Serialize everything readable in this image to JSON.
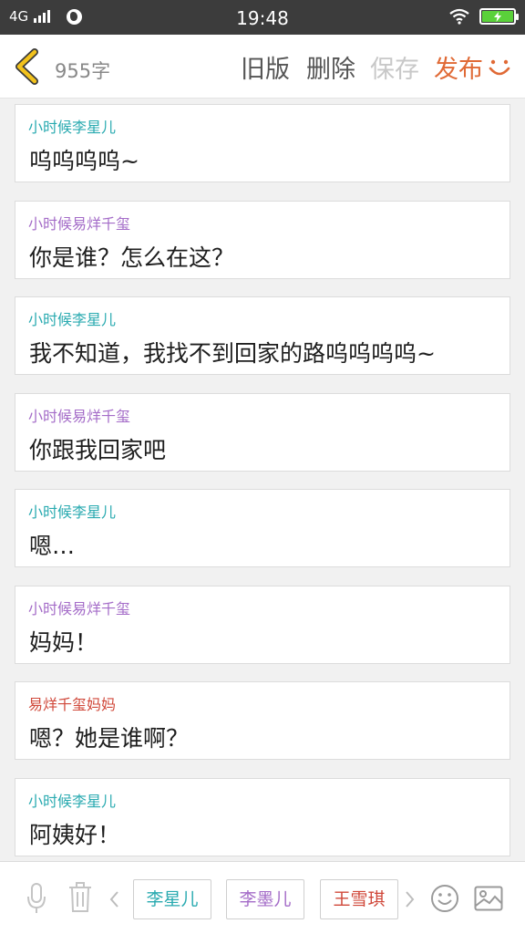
{
  "status_bar": {
    "network": "4G",
    "time": "19:48",
    "battery_level": 1.0,
    "battery_charging_icon": "lightning-bolt-icon"
  },
  "toolbar": {
    "back_icon": "chevron-left-icon",
    "word_count": "955字",
    "old_version_label": "旧版",
    "delete_label": "删除",
    "save_label": "保存",
    "publish_label": "发布",
    "smile_icon": "smile-icon"
  },
  "colors": {
    "teal": "#29aab0",
    "purple": "#a46cc8",
    "red": "#d0483a",
    "publish": "#e06a36",
    "back_arrow": "#f2c21c"
  },
  "messages": [
    {
      "speaker": "小时候李星儿",
      "text": "呜呜呜呜~",
      "color": "#29aab0"
    },
    {
      "speaker": "小时候易烊千玺",
      "text": "你是谁？怎么在这？",
      "color": "#a46cc8"
    },
    {
      "speaker": "小时候李星儿",
      "text": "我不知道，我找不到回家的路呜呜呜呜~",
      "color": "#29aab0"
    },
    {
      "speaker": "小时候易烊千玺",
      "text": "你跟我回家吧",
      "color": "#a46cc8"
    },
    {
      "speaker": "小时候李星儿",
      "text": "嗯…",
      "color": "#29aab0"
    },
    {
      "speaker": "小时候易烊千玺",
      "text": "妈妈！",
      "color": "#a46cc8"
    },
    {
      "speaker": "易烊千玺妈妈",
      "text": "嗯？她是谁啊？",
      "color": "#d0483a"
    },
    {
      "speaker": "小时候李星儿",
      "text": "阿姨好！",
      "color": "#29aab0"
    }
  ],
  "bottom_bar": {
    "mic_icon": "microphone-icon",
    "trash_icon": "trash-icon",
    "prev_icon": "chevron-left-icon",
    "next_icon": "chevron-right-icon",
    "emoji_icon": "emoji-icon",
    "image_icon": "image-icon",
    "characters": [
      {
        "name": "李星儿",
        "color": "#29aab0"
      },
      {
        "name": "李墨儿",
        "color": "#a46cc8"
      },
      {
        "name": "王雪琪",
        "color": "#d0483a"
      }
    ]
  }
}
